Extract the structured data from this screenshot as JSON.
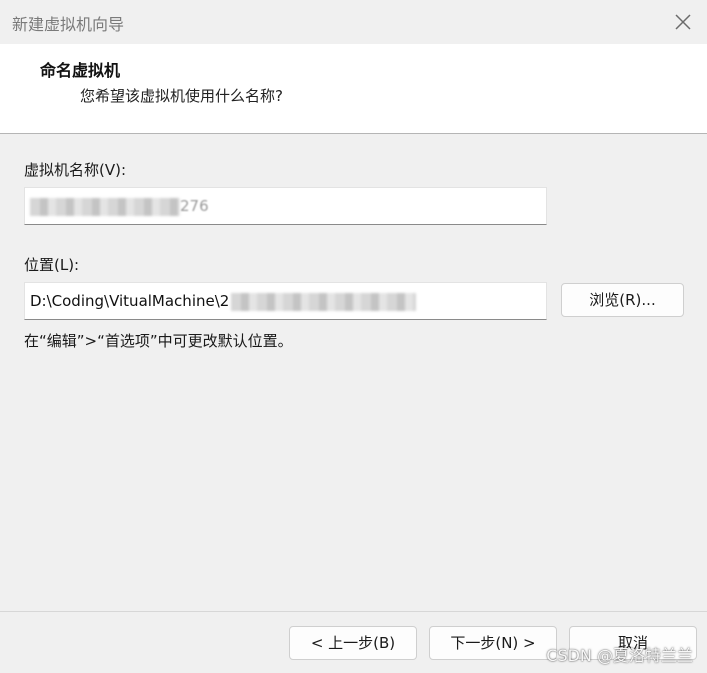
{
  "window": {
    "title": "新建虚拟机向导",
    "close_icon": "close-icon"
  },
  "header": {
    "title": "命名虚拟机",
    "subtitle": "您希望该虚拟机使用什么名称?"
  },
  "form": {
    "name_label": "虚拟机名称(V):",
    "name_value_visible": "276",
    "location_label": "位置(L):",
    "location_value": "D:\\Coding\\VitualMachine\\2",
    "browse_label": "浏览(R)...",
    "hint": "在“编辑”>“首选项”中可更改默认位置。"
  },
  "footer": {
    "back_label": "< 上一步(B)",
    "next_label": "下一步(N) >",
    "cancel_label": "取消"
  },
  "watermark": "CSDN @夏洛特兰兰"
}
